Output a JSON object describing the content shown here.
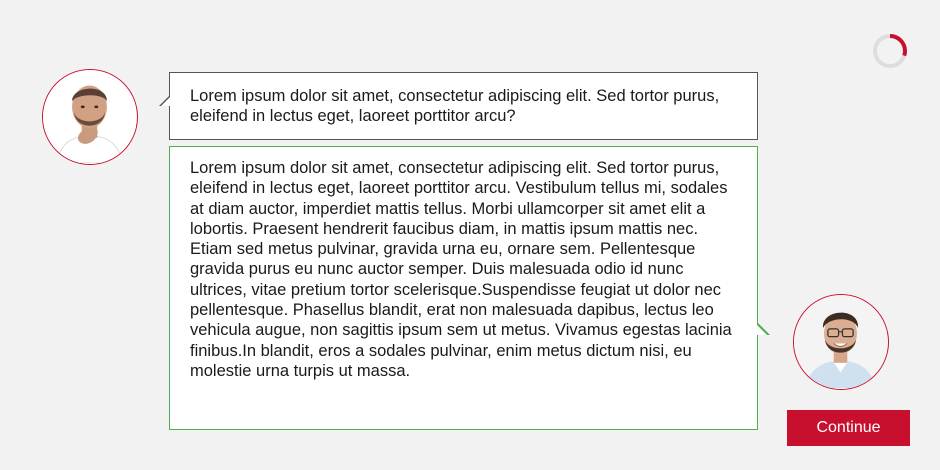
{
  "conversation": {
    "question": "Lorem ipsum dolor sit amet, consectetur adipiscing elit. Sed tortor purus, eleifend in lectus eget, laoreet porttitor arcu?",
    "answer": "Lorem ipsum dolor sit amet, consectetur adipiscing elit. Sed tortor purus, eleifend in lectus eget, laoreet porttitor arcu. Vestibulum tellus mi, sodales at diam auctor, imperdiet mattis tellus. Morbi ullamcorper sit amet elit a lobortis. Praesent hendrerit faucibus diam, in mattis ipsum mattis nec. Etiam sed metus pulvinar, gravida urna eu, ornare sem. Pellentesque gravida purus eu nunc auctor semper. Duis malesuada odio id nunc ultrices, vitae pretium tortor scelerisque.Suspendisse feugiat ut dolor nec pellentesque. Phasellus blandit, erat non malesuada dapibus, lectus leo vehicula augue, non sagittis ipsum sem ut metus. Vivamus egestas lacinia finibus.In blandit, eros a sodales pulvinar, enim metus dictum nisi, eu molestie urna turpis ut massa."
  },
  "controls": {
    "continue_label": "Continue"
  },
  "progress": {
    "fraction": 0.3
  },
  "colors": {
    "accent": "#c8102e",
    "answer_border": "#4caf50",
    "question_border": "#555555",
    "background": "#f2f2f2"
  },
  "icons": {
    "progress": "progress-ring-icon",
    "asker": "avatar-thinking-man",
    "responder": "avatar-smiling-man"
  }
}
